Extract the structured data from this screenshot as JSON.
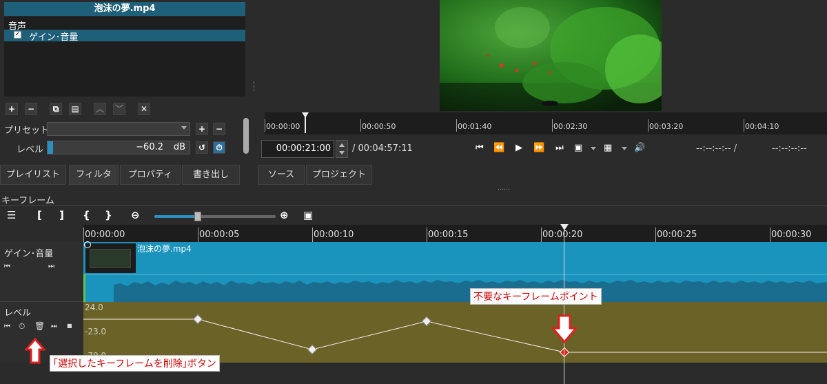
{
  "filter_panel": {
    "file_title": "泡沫の夢.mp4",
    "section": "音声",
    "filter_item": "ゲイン･音量",
    "checkbox_mark": "✓",
    "preset_label": "プリセット",
    "level_label": "レベル",
    "level_value": "−60.2",
    "level_unit": "dB"
  },
  "player": {
    "ruler_labels": [
      "00:00:00",
      "00:00:50",
      "00:01:40",
      "00:02:30",
      "00:03:20",
      "00:04:10"
    ],
    "current_time": "00:00:21:00",
    "total_time": "/ 00:04:57:11",
    "in_point": "--:--:--:-- /",
    "out_point": "--:--:--:--"
  },
  "tabs": [
    "プレイリスト",
    "フィルタ",
    "プロパティ",
    "書き出し",
    "ソース",
    "プロジェクト"
  ],
  "keyframes": {
    "title": "キーフレーム",
    "ruler_labels": [
      "00:00:00",
      "00:00:05",
      "00:00:10",
      "00:00:15",
      "00:00:20",
      "00:00:25",
      "00:00:30"
    ],
    "track_clip": "ゲイン･音量",
    "track_level": "レベル",
    "clip_name": "泡沫の夢.mp4",
    "level_top": "24.0",
    "level_mid": "-23.0",
    "level_bottom": "-70.0"
  },
  "annotations": {
    "unneeded_point": "不要なキーフレームポイント",
    "delete_button": "｢選択したキーフレームを削除｣ボタン"
  },
  "colors": {
    "selection": "#1e5f7a",
    "clip": "#1a93bd",
    "level_track": "#6b6228",
    "annotation_arrow": "#e02020"
  }
}
